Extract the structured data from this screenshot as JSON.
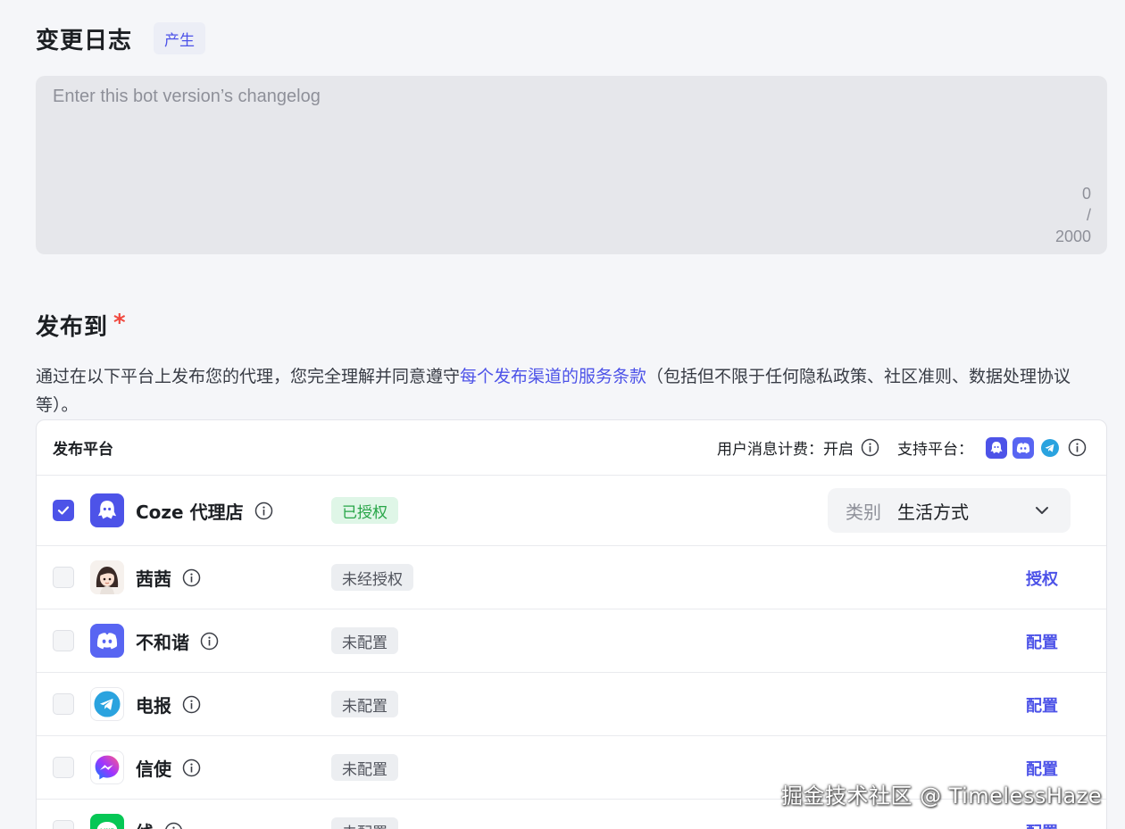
{
  "changelog": {
    "title": "变更日志",
    "generate_label": "产生",
    "placeholder": "Enter this bot version’s changelog",
    "counter_current": "0",
    "counter_sep": "/",
    "counter_max": "2000"
  },
  "publish": {
    "title": "发布到",
    "required_mark": "*",
    "terms_before": "通过在以下平台上发布您的代理，您完全理解并同意遵守",
    "terms_link": "每个发布渠道的服务条款",
    "terms_after": "（包括但不限于任何隐私政策、社区准则、数据处理协议等）。"
  },
  "table": {
    "header_title": "发布平台",
    "billing_label": "用户消息计费：开启",
    "support_label": "支持平台：",
    "support_icons": [
      "coze-icon",
      "discord-icon",
      "telegram-icon"
    ]
  },
  "platforms": [
    {
      "name": "Coze 代理店",
      "status": "已授权",
      "status_ok": true,
      "checked": true,
      "icon": "coze-icon",
      "category_label": "类别",
      "category_value": "生活方式"
    },
    {
      "name": "茜茜",
      "status": "未经授权",
      "action": "授权",
      "icon": "avatar-icon"
    },
    {
      "name": "不和谐",
      "status": "未配置",
      "action": "配置",
      "icon": "discord-icon"
    },
    {
      "name": "电报",
      "status": "未配置",
      "action": "配置",
      "icon": "telegram-icon"
    },
    {
      "name": "信使",
      "status": "未配置",
      "action": "配置",
      "icon": "messenger-icon"
    },
    {
      "name": "线",
      "status": "未配置",
      "action": "配置",
      "icon": "line-icon"
    }
  ],
  "watermark": "掘金技术社区 @ TimelessHaze",
  "colors": {
    "accent": "#4d53e8",
    "required": "#f0483e",
    "authorized_bg": "#dff6e7",
    "authorized_text": "#27a547",
    "page_bg": "#f5f6f9"
  }
}
